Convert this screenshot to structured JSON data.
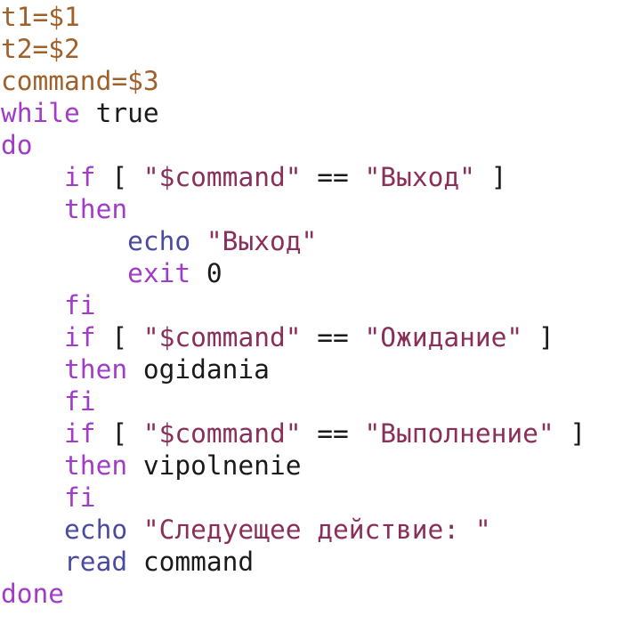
{
  "editor": {
    "lines": [
      [
        {
          "text": "t1=$1",
          "cls": "t-var"
        }
      ],
      [
        {
          "text": "t2=$2",
          "cls": "t-var"
        }
      ],
      [
        {
          "text": "command=$3",
          "cls": "t-var"
        }
      ],
      [
        {
          "text": "while",
          "cls": "t-kw"
        },
        {
          "text": " true",
          "cls": "t-plain"
        }
      ],
      [
        {
          "text": "do",
          "cls": "t-kw"
        }
      ],
      [
        {
          "text": "    ",
          "cls": "t-plain"
        },
        {
          "text": "if",
          "cls": "t-kw"
        },
        {
          "text": " [ ",
          "cls": "t-plain"
        },
        {
          "text": "\"$command\"",
          "cls": "t-str"
        },
        {
          "text": " == ",
          "cls": "t-plain"
        },
        {
          "text": "\"Выход\"",
          "cls": "t-str"
        },
        {
          "text": " ]",
          "cls": "t-plain"
        }
      ],
      [
        {
          "text": "    ",
          "cls": "t-plain"
        },
        {
          "text": "then",
          "cls": "t-kw"
        }
      ],
      [
        {
          "text": "        ",
          "cls": "t-plain"
        },
        {
          "text": "echo",
          "cls": "t-cmd"
        },
        {
          "text": " ",
          "cls": "t-plain"
        },
        {
          "text": "\"Выход\"",
          "cls": "t-str"
        }
      ],
      [
        {
          "text": "        ",
          "cls": "t-plain"
        },
        {
          "text": "exit",
          "cls": "t-kw"
        },
        {
          "text": " 0",
          "cls": "t-plain"
        }
      ],
      [
        {
          "text": "    ",
          "cls": "t-plain"
        },
        {
          "text": "fi",
          "cls": "t-kw"
        }
      ],
      [
        {
          "text": "    ",
          "cls": "t-plain"
        },
        {
          "text": "if",
          "cls": "t-kw"
        },
        {
          "text": " [ ",
          "cls": "t-plain"
        },
        {
          "text": "\"$command\"",
          "cls": "t-str"
        },
        {
          "text": " == ",
          "cls": "t-plain"
        },
        {
          "text": "\"Ожидание\"",
          "cls": "t-str"
        },
        {
          "text": " ]",
          "cls": "t-plain"
        }
      ],
      [
        {
          "text": "    ",
          "cls": "t-plain"
        },
        {
          "text": "then",
          "cls": "t-kw"
        },
        {
          "text": " ogidania",
          "cls": "t-plain"
        }
      ],
      [
        {
          "text": "    ",
          "cls": "t-plain"
        },
        {
          "text": "fi",
          "cls": "t-kw"
        }
      ],
      [
        {
          "text": "    ",
          "cls": "t-plain"
        },
        {
          "text": "if",
          "cls": "t-kw"
        },
        {
          "text": " [ ",
          "cls": "t-plain"
        },
        {
          "text": "\"$command\"",
          "cls": "t-str"
        },
        {
          "text": " == ",
          "cls": "t-plain"
        },
        {
          "text": "\"Выполнение\"",
          "cls": "t-str"
        },
        {
          "text": " ]",
          "cls": "t-plain"
        }
      ],
      [
        {
          "text": "    ",
          "cls": "t-plain"
        },
        {
          "text": "then",
          "cls": "t-kw"
        },
        {
          "text": " vipolnenie",
          "cls": "t-plain"
        }
      ],
      [
        {
          "text": "    ",
          "cls": "t-plain"
        },
        {
          "text": "fi",
          "cls": "t-kw"
        }
      ],
      [
        {
          "text": "    ",
          "cls": "t-plain"
        },
        {
          "text": "echo",
          "cls": "t-cmd"
        },
        {
          "text": " ",
          "cls": "t-plain"
        },
        {
          "text": "\"Следуещее действие: \"",
          "cls": "t-str"
        }
      ],
      [
        {
          "text": "    ",
          "cls": "t-plain"
        },
        {
          "text": "read",
          "cls": "t-cmd"
        },
        {
          "text": " command",
          "cls": "t-plain"
        }
      ],
      [
        {
          "text": "done",
          "cls": "t-kw"
        }
      ]
    ]
  },
  "colors": {
    "variable": "#a0602a",
    "keyword": "#a23bc8",
    "string": "#8a2e5a",
    "builtin": "#4a4aa0",
    "plain": "#1a1a1a",
    "background": "#ffffff"
  }
}
